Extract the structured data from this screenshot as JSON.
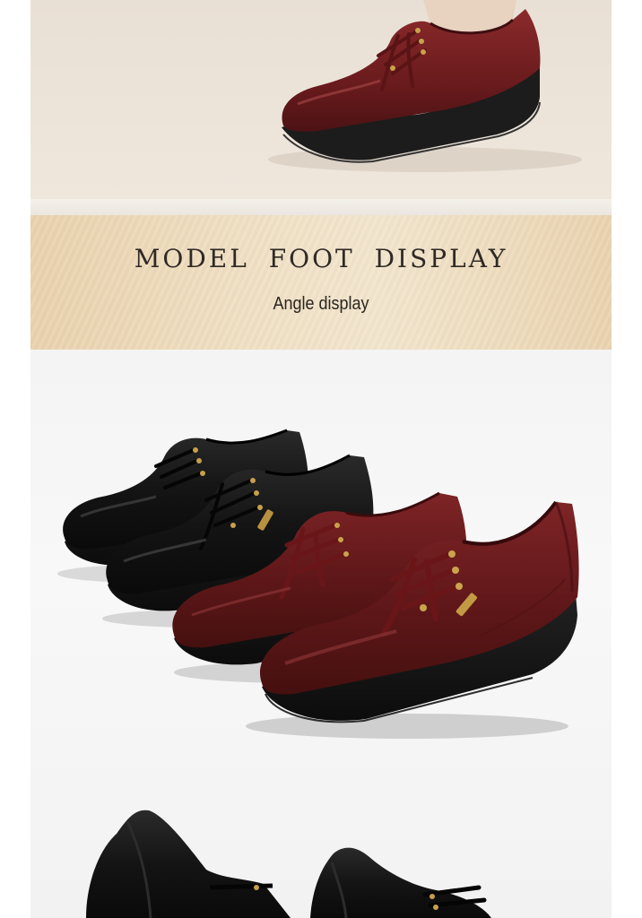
{
  "banner": {
    "title": "MODEL FOOT DISPLAY",
    "subtitle": "Angle display"
  },
  "photos": {
    "top": "model-foot-photo",
    "middle": "angle-display-photo",
    "bottom": "partial-shoes-photo"
  },
  "colors": {
    "banner_bg": "#efdcbc",
    "burgundy": "#6e1c1f",
    "black_leather": "#151515",
    "title_text": "#2f2a25"
  }
}
